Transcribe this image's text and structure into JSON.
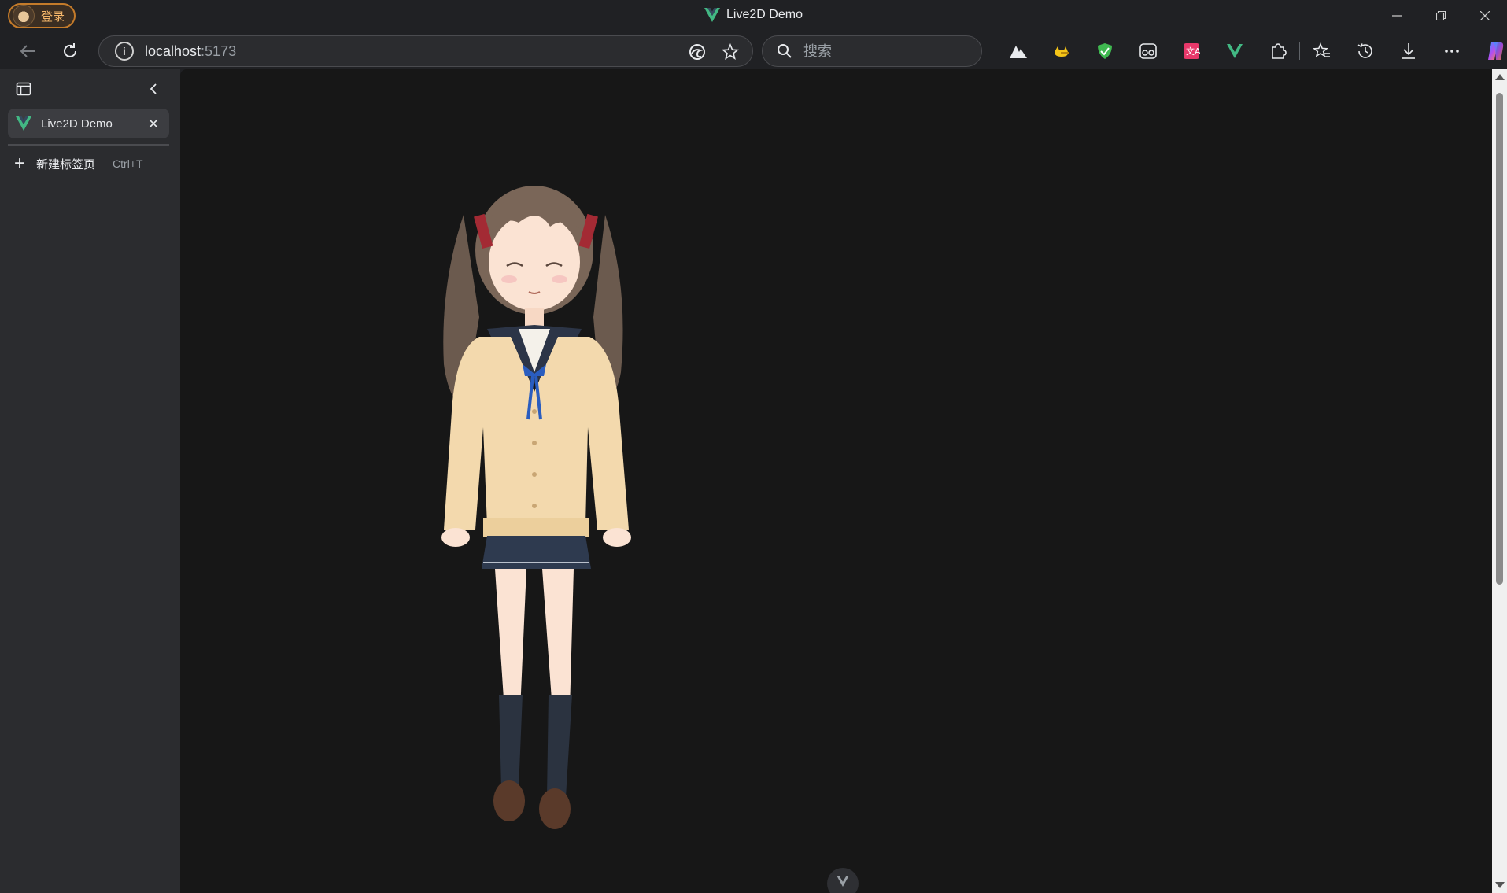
{
  "window": {
    "title": "Live2D Demo",
    "profile_label": "登录",
    "controls": [
      "minimize-icon",
      "restore-icon",
      "close-icon"
    ]
  },
  "toolbar": {
    "address": {
      "host": "localhost",
      "port": ":5173"
    },
    "search": {
      "placeholder": "搜索"
    },
    "extensions": [
      "mountain-icon",
      "cat-icon",
      "shield-check-icon",
      "glasses-icon",
      "translate-icon",
      "vue-devtools-icon",
      "puzzle-icon",
      "favorites-icon",
      "history-icon",
      "download-icon",
      "more-icon",
      "copilot-icon"
    ]
  },
  "sidebar": {
    "tabs": [
      {
        "label": "Live2D Demo",
        "active": true
      }
    ],
    "new_tab": {
      "label": "新建标签页",
      "shortcut": "Ctrl+T"
    }
  },
  "colors": {
    "accent_vue": "#42b883",
    "page_background": "#171717",
    "chrome_background": "#202124",
    "profile_accent": "#f3b56a"
  }
}
